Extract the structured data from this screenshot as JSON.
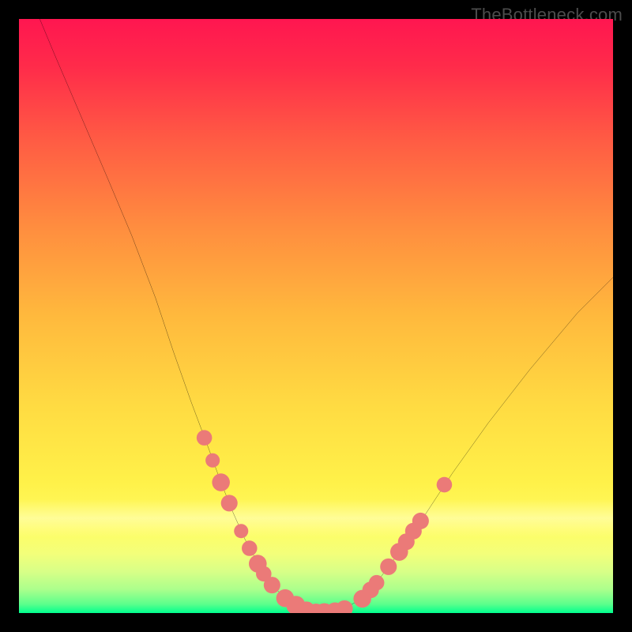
{
  "watermark": "TheBottleneck.com",
  "chart_data": {
    "type": "line",
    "title": "",
    "xlabel": "",
    "ylabel": "",
    "xlim": [
      0,
      100
    ],
    "ylim": [
      0,
      100
    ],
    "grid": false,
    "legend": false,
    "series": [
      {
        "name": "bottleneck-curve",
        "x": [
          3.5,
          6,
          9,
          12,
          15,
          19,
          23,
          26,
          29,
          32,
          34,
          36,
          38,
          40,
          41.5,
          43,
          44.5,
          46,
          47.5,
          49,
          51,
          53,
          55,
          57,
          59,
          61,
          64,
          68,
          73,
          79,
          86,
          94,
          100
        ],
        "y": [
          100,
          94,
          87,
          80,
          73,
          63.5,
          53,
          44,
          35.5,
          27.5,
          22,
          17,
          12.5,
          8.8,
          6.3,
          4.3,
          2.8,
          1.6,
          0.9,
          0.4,
          0.15,
          0.25,
          0.9,
          2,
          3.8,
          6.2,
          10.2,
          16,
          23.6,
          32,
          41,
          50.5,
          56.5
        ]
      }
    ],
    "markers": [
      {
        "x": 31.2,
        "y": 29.5,
        "r": 1.3
      },
      {
        "x": 32.6,
        "y": 25.7,
        "r": 1.2
      },
      {
        "x": 34.0,
        "y": 22.0,
        "r": 1.5
      },
      {
        "x": 35.4,
        "y": 18.5,
        "r": 1.4
      },
      {
        "x": 37.4,
        "y": 13.8,
        "r": 1.2
      },
      {
        "x": 38.8,
        "y": 10.9,
        "r": 1.3
      },
      {
        "x": 40.2,
        "y": 8.3,
        "r": 1.5
      },
      {
        "x": 41.2,
        "y": 6.6,
        "r": 1.3
      },
      {
        "x": 42.6,
        "y": 4.7,
        "r": 1.4
      },
      {
        "x": 44.8,
        "y": 2.5,
        "r": 1.5
      },
      {
        "x": 46.6,
        "y": 1.3,
        "r": 1.6
      },
      {
        "x": 48.4,
        "y": 0.55,
        "r": 1.4
      },
      {
        "x": 50.0,
        "y": 0.2,
        "r": 1.4
      },
      {
        "x": 51.4,
        "y": 0.17,
        "r": 1.5
      },
      {
        "x": 53.2,
        "y": 0.3,
        "r": 1.5
      },
      {
        "x": 54.8,
        "y": 0.75,
        "r": 1.4
      },
      {
        "x": 57.8,
        "y": 2.4,
        "r": 1.5
      },
      {
        "x": 59.2,
        "y": 3.9,
        "r": 1.4
      },
      {
        "x": 60.2,
        "y": 5.1,
        "r": 1.3
      },
      {
        "x": 62.2,
        "y": 7.8,
        "r": 1.4
      },
      {
        "x": 64.0,
        "y": 10.3,
        "r": 1.5
      },
      {
        "x": 65.2,
        "y": 12.0,
        "r": 1.4
      },
      {
        "x": 66.4,
        "y": 13.8,
        "r": 1.4
      },
      {
        "x": 67.6,
        "y": 15.5,
        "r": 1.4
      },
      {
        "x": 71.6,
        "y": 21.6,
        "r": 1.3
      }
    ],
    "marker_color": "#eb7a78",
    "curve_color": "#000000",
    "gradient_stops": [
      {
        "offset": 0,
        "color": "#ff1650"
      },
      {
        "offset": 50,
        "color": "#ffb93d"
      },
      {
        "offset": 86,
        "color": "#fffd64"
      },
      {
        "offset": 100,
        "color": "#00ff8e"
      }
    ]
  }
}
